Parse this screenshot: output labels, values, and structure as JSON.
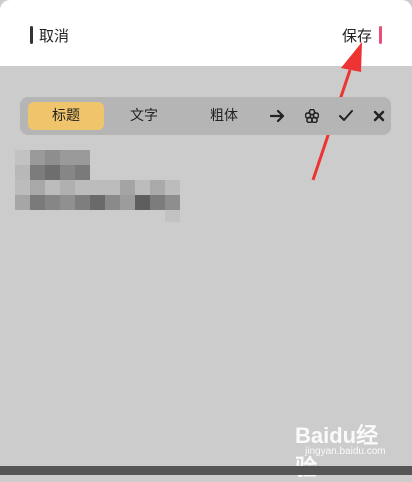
{
  "header": {
    "cancel_label": "取消",
    "save_label": "保存",
    "save_accent": "#e8507a"
  },
  "toolbar": {
    "items": [
      {
        "label": "标题",
        "active": true
      },
      {
        "label": "文字",
        "active": false
      },
      {
        "label": "粗体",
        "active": false
      }
    ],
    "icons": [
      "arrow-right-icon",
      "flower-icon",
      "check-icon",
      "close-icon"
    ],
    "active_color": "#f0c46a"
  },
  "watermark": {
    "text": "Baidu经验",
    "sub": "jingyan.baidu.com"
  },
  "annotation": {
    "type": "red-arrow",
    "target": "save-button",
    "color": "#ee3333"
  }
}
